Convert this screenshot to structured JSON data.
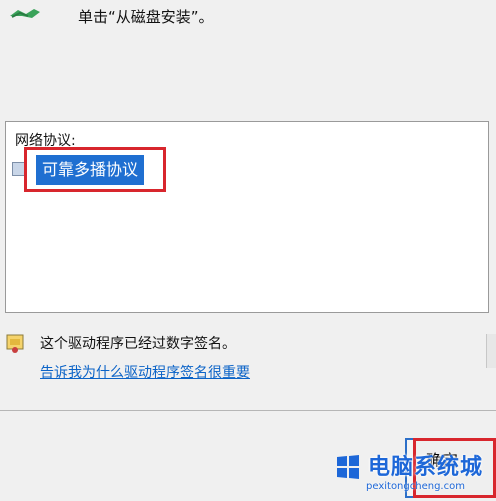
{
  "header": {
    "hint": "单击“从磁盘安装”。"
  },
  "network_list": {
    "header": "网络协议:",
    "items": [
      {
        "label": "可靠多播协议",
        "selected": true
      }
    ]
  },
  "signature": {
    "status": "这个驱动程序已经过数字签名。",
    "link": "告诉我为什么驱动程序签名很重要"
  },
  "buttons": {
    "ok": "确定"
  },
  "watermark": {
    "name": "电脑系统城",
    "url": "pexitongcheng.com"
  },
  "colors": {
    "selection": "#1f6fd1",
    "highlight_frame": "#d8262d",
    "link": "#0b63c7"
  }
}
